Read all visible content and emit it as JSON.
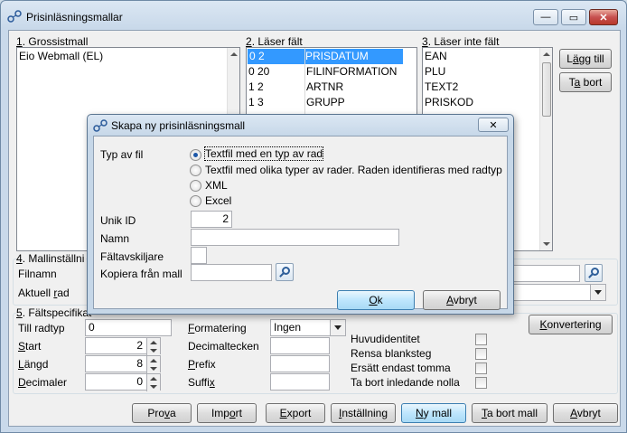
{
  "window": {
    "title": "Prisinläsningsmallar",
    "min_glyph": "—",
    "max_glyph": "▭",
    "close_glyph": "✕"
  },
  "grossistmall": {
    "accel": "1",
    "label": ". Grossistmall",
    "items": [
      "Eio Webmall (EL)"
    ]
  },
  "laser_falt": {
    "accel": "2",
    "label": ". Läser fält",
    "items": [
      {
        "pos": "0  2",
        "name": "PRISDATUM",
        "selected": true
      },
      {
        "pos": "0  20",
        "name": "FILINFORMATION",
        "selected": false
      },
      {
        "pos": "1  2",
        "name": "ARTNR",
        "selected": false
      },
      {
        "pos": "1  3",
        "name": "GRUPP",
        "selected": false
      }
    ]
  },
  "laser_inte_falt": {
    "accel": "3",
    "label": ". Läser inte fält",
    "items": [
      "EAN",
      "PLU",
      "TEXT2",
      "PRISKOD"
    ]
  },
  "side_buttons": {
    "add": {
      "pre": "L",
      "accel": "ä",
      "post": "gg till"
    },
    "remove": {
      "pre": "T",
      "accel": "a",
      "post": " bort"
    }
  },
  "mallinst": {
    "accel": "4",
    "label": ". Mallinställni",
    "filnamn": "Filnamn",
    "aktuell_pre": "Aktuell ",
    "aktuell_accel": "r",
    "aktuell_post": "ad"
  },
  "faltspec": {
    "accel": "5",
    "label": ". Fältspecifikat",
    "till_radtyp": "Till radtyp",
    "till_radtyp_value": "0",
    "start_accel": "S",
    "start_post": "tart",
    "start_value": "2",
    "langd_accel": "L",
    "langd_post": "ängd",
    "langd_value": "8",
    "decimaler_accel": "D",
    "decimaler_post": "ecimaler",
    "decimaler_value": "0",
    "formatering_accel": "F",
    "formatering_post": "ormatering",
    "formatering_value": "Ingen",
    "decimaltecken": "Decimaltecken",
    "prefix_accel": "P",
    "prefix_post": "refix",
    "suffix_pre": "Suffi",
    "suffix_accel": "x",
    "huvud": "Huvudidentitet",
    "rensa": "Rensa blanksteg",
    "ersatt": "Ersätt endast tomma",
    "tabort_nolla": "Ta bort inledande nolla",
    "konvertering": {
      "accel": "K",
      "post": "onvertering"
    }
  },
  "bottom_buttons": [
    {
      "name": "prova-button",
      "pre": "Pro",
      "accel": "v",
      "post": "a"
    },
    {
      "name": "import-button",
      "pre": "Imp",
      "accel": "o",
      "post": "rt"
    },
    {
      "name": "export-button",
      "pre": "",
      "accel": "E",
      "post": "xport"
    },
    {
      "name": "installning-button",
      "pre": "",
      "accel": "I",
      "post": "nställning"
    },
    {
      "name": "ny-mall-button",
      "pre": "",
      "accel": "N",
      "post": "y mall"
    },
    {
      "name": "ta-bort-mall-button",
      "pre": "",
      "accel": "T",
      "post": "a bort mall"
    },
    {
      "name": "avbryt-button",
      "pre": "",
      "accel": "A",
      "post": "vbryt"
    }
  ],
  "dialog": {
    "title": "Skapa ny prisinläsningsmall",
    "typ_av_fil": "Typ av fil",
    "options": [
      {
        "label": "Textfil med en typ av rad",
        "checked": true
      },
      {
        "label": "Textfil med olika typer av rader. Raden identifieras med radtyp",
        "checked": false
      },
      {
        "label": "XML",
        "checked": false
      },
      {
        "label": "Excel",
        "checked": false
      }
    ],
    "unik_id": "Unik ID",
    "unik_id_value": "2",
    "namn": "Namn",
    "faltavskiljare": "Fältavskiljare",
    "kopiera": "Kopiera från mall",
    "ok": {
      "accel": "O",
      "post": "k"
    },
    "avbryt": {
      "accel": "A",
      "post": "vbryt"
    }
  }
}
